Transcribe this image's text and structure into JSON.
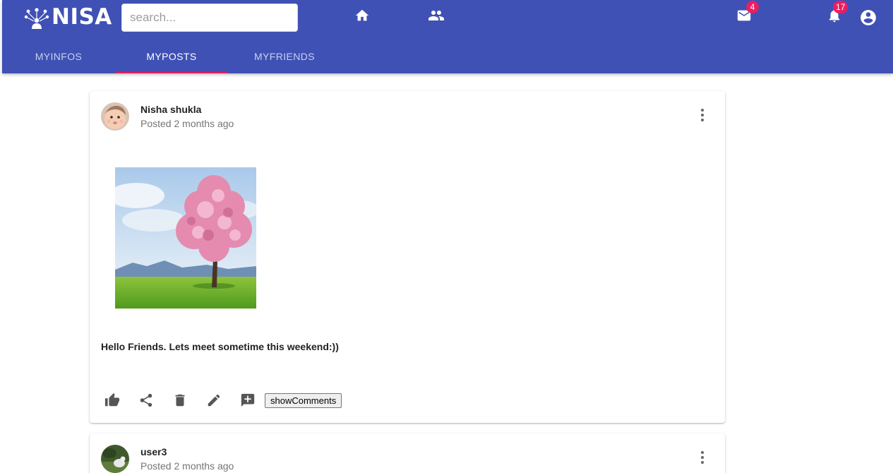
{
  "app": {
    "logo_text": "NISA",
    "search": {
      "placeholder": "search...",
      "value": ""
    },
    "nav_icons": [
      "home-icon",
      "people-icon"
    ],
    "messages": {
      "icon": "mail-icon",
      "count": "4"
    },
    "notifications": {
      "icon": "bell-icon",
      "count": "17"
    },
    "account": {
      "icon": "account-circle-icon"
    },
    "colors": {
      "primary": "#3f51b5",
      "accent": "#e91e63"
    }
  },
  "tabs": [
    {
      "label": "MYINFOS",
      "active": false
    },
    {
      "label": "MYPOSTS",
      "active": true
    },
    {
      "label": "MYFRIENDS",
      "active": false
    }
  ],
  "posts": [
    {
      "author": "Nisha shukla",
      "posted": "Posted 2 months ago",
      "image": "cherry-blossom-tree-photo",
      "text": "Hello Friends. Lets meet sometime this weekend:))",
      "actions": [
        "thumb-up-icon",
        "share-icon",
        "delete-icon",
        "edit-icon",
        "add-comment-icon"
      ],
      "show_comments_label": "showComments"
    },
    {
      "author": "user3",
      "posted": "Posted 2 months ago"
    }
  ]
}
